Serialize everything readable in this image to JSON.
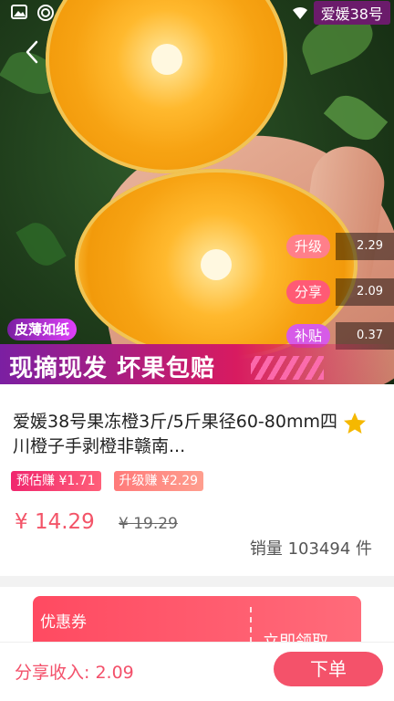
{
  "status_bar": {
    "left_icons": [
      "image-icon",
      "swirl-icon"
    ],
    "time_tag": "爱媛38号"
  },
  "hero": {
    "promo_small": "皮薄如纸",
    "promo_banner": "现摘现发 坏果包赔",
    "earnings": [
      {
        "label": "升级",
        "value": "2.29",
        "color": "#ff7f8a"
      },
      {
        "label": "分享",
        "value": "2.09",
        "color": "#ff5a75"
      },
      {
        "label": "补贴",
        "value": "0.37",
        "color": "#d65be8"
      }
    ]
  },
  "product": {
    "title": "爱媛38号果冻橙3斤/5斤果径60-80mm四川橙子手剥橙非赣南...",
    "badge_estimated": "预估赚 ¥1.71",
    "badge_upgrade": "升级赚 ¥2.29",
    "price": "¥ 14.29",
    "original_price": "¥ 19.29",
    "sales": "销量 103494 件"
  },
  "coupon": {
    "label": "优惠券",
    "action": "立即领取"
  },
  "bottom": {
    "share_income": "分享收入: 2.09",
    "order_button": "下单"
  },
  "colors": {
    "accent": "#f4526a",
    "price": "#f35468",
    "star": "#f5b800"
  }
}
